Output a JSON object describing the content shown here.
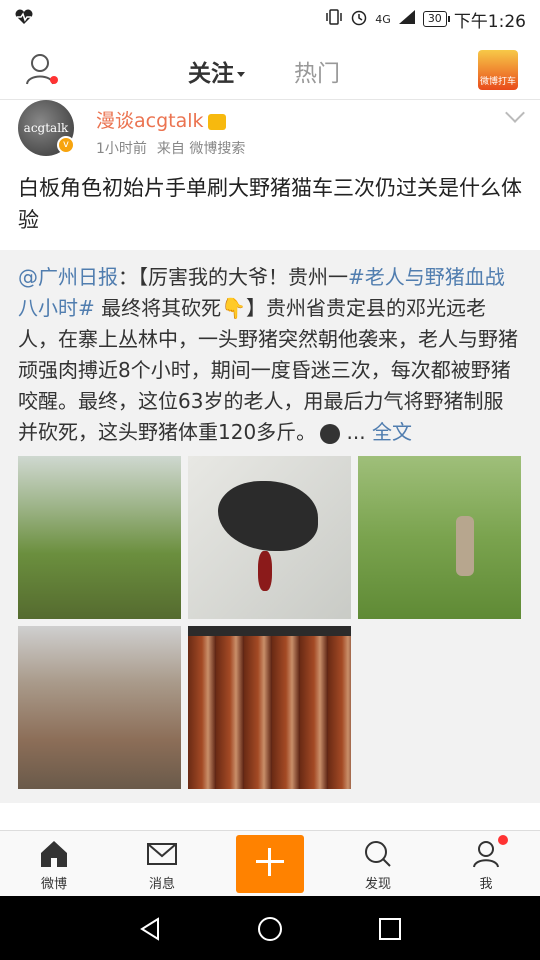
{
  "status_bar": {
    "network": "4G",
    "battery": "30",
    "time": "下午1:26",
    "icons": [
      "heartbeat-icon",
      "vibrate-icon",
      "alarm-icon",
      "signal-icon"
    ]
  },
  "top_nav": {
    "tab_follow": "关注",
    "tab_hot": "热门",
    "taxi_label": "微博打车"
  },
  "post": {
    "author": "漫谈acgtalk",
    "avatar_text": "acgtalk",
    "time": "1小时前",
    "source": "来自 微博搜索",
    "text": "白板角色初始片手单刷大野猪猫车三次仍过关是什么体验",
    "repost": {
      "mention": "@广州日报",
      "colon": "：【厉害我的大爷！贵州一",
      "hashtag": "#老人与野猪血战八小时#",
      "body1": " 最终将其砍死",
      "body2": "】贵州省贵定县的邓光远老人，在寨上丛林中，一头野猪突然朝他袭来，老人与野猪顽强肉搏近8个小时，期间一度昏迷三次，每次都被野猪咬醒。最终，这位63岁的老人，用最后力气将野猪制服并砍死，这头野猪体重120多斤。",
      "ellipsis": " ... ",
      "more": "全文"
    }
  },
  "bottom_nav": {
    "home": "微博",
    "message": "消息",
    "discover": "发现",
    "me": "我"
  },
  "colors": {
    "accent": "#ff8200",
    "author_name": "#eb7350",
    "link": "#507daf"
  }
}
